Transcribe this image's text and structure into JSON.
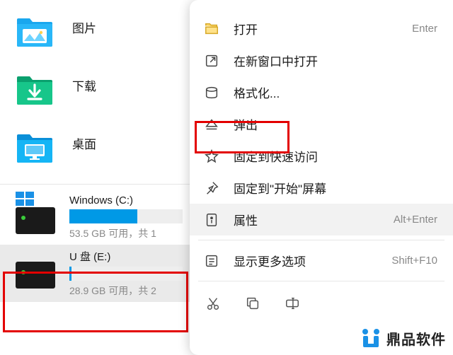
{
  "sidebar": {
    "folders": [
      {
        "label": "图片",
        "icon": "pictures"
      },
      {
        "label": "下载",
        "icon": "downloads"
      },
      {
        "label": "桌面",
        "icon": "desktop"
      }
    ],
    "drives": [
      {
        "name": "Windows (C:)",
        "stats": "53.5 GB 可用，共 1",
        "fill_pct": 60,
        "has_win_logo": true,
        "selected": false
      },
      {
        "name": "U 盘 (E:)",
        "stats": "28.9 GB 可用，共 2",
        "fill_pct": 2,
        "has_win_logo": false,
        "selected": true
      }
    ]
  },
  "context_menu": {
    "items": [
      {
        "label": "打开",
        "accel": "Enter",
        "icon": "folder-open",
        "sel": false
      },
      {
        "label": "在新窗口中打开",
        "accel": "",
        "icon": "open-new",
        "sel": false
      },
      {
        "label": "格式化...",
        "accel": "",
        "icon": "format",
        "sel": false
      },
      {
        "label": "弹出",
        "accel": "",
        "icon": "eject",
        "sel": false
      },
      {
        "label": "固定到快速访问",
        "accel": "",
        "icon": "star",
        "sel": false
      },
      {
        "label": "固定到\"开始\"屏幕",
        "accel": "",
        "icon": "pin",
        "sel": false
      },
      {
        "label": "属性",
        "accel": "Alt+Enter",
        "icon": "properties",
        "sel": true
      },
      {
        "label": "显示更多选项",
        "accel": "Shift+F10",
        "icon": "more",
        "sel": false
      }
    ],
    "bottom_icons": [
      "cut",
      "copy",
      "rename"
    ]
  },
  "watermark": {
    "text": "鼎品软件"
  },
  "colors": {
    "accent_blue": "#0099e6",
    "highlight_red": "#e30000"
  }
}
